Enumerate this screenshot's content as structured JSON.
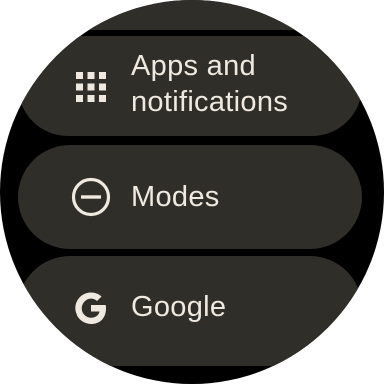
{
  "menu": {
    "items": [
      {
        "label": "Apps and",
        "label_line2": "notifications",
        "icon": "apps-grid-icon"
      },
      {
        "label": "Modes",
        "icon": "modes-icon"
      },
      {
        "label": "Google",
        "icon": "google-g-icon"
      }
    ]
  },
  "colors": {
    "background": "#000000",
    "chip": "#302e29",
    "text": "#efe9df"
  }
}
